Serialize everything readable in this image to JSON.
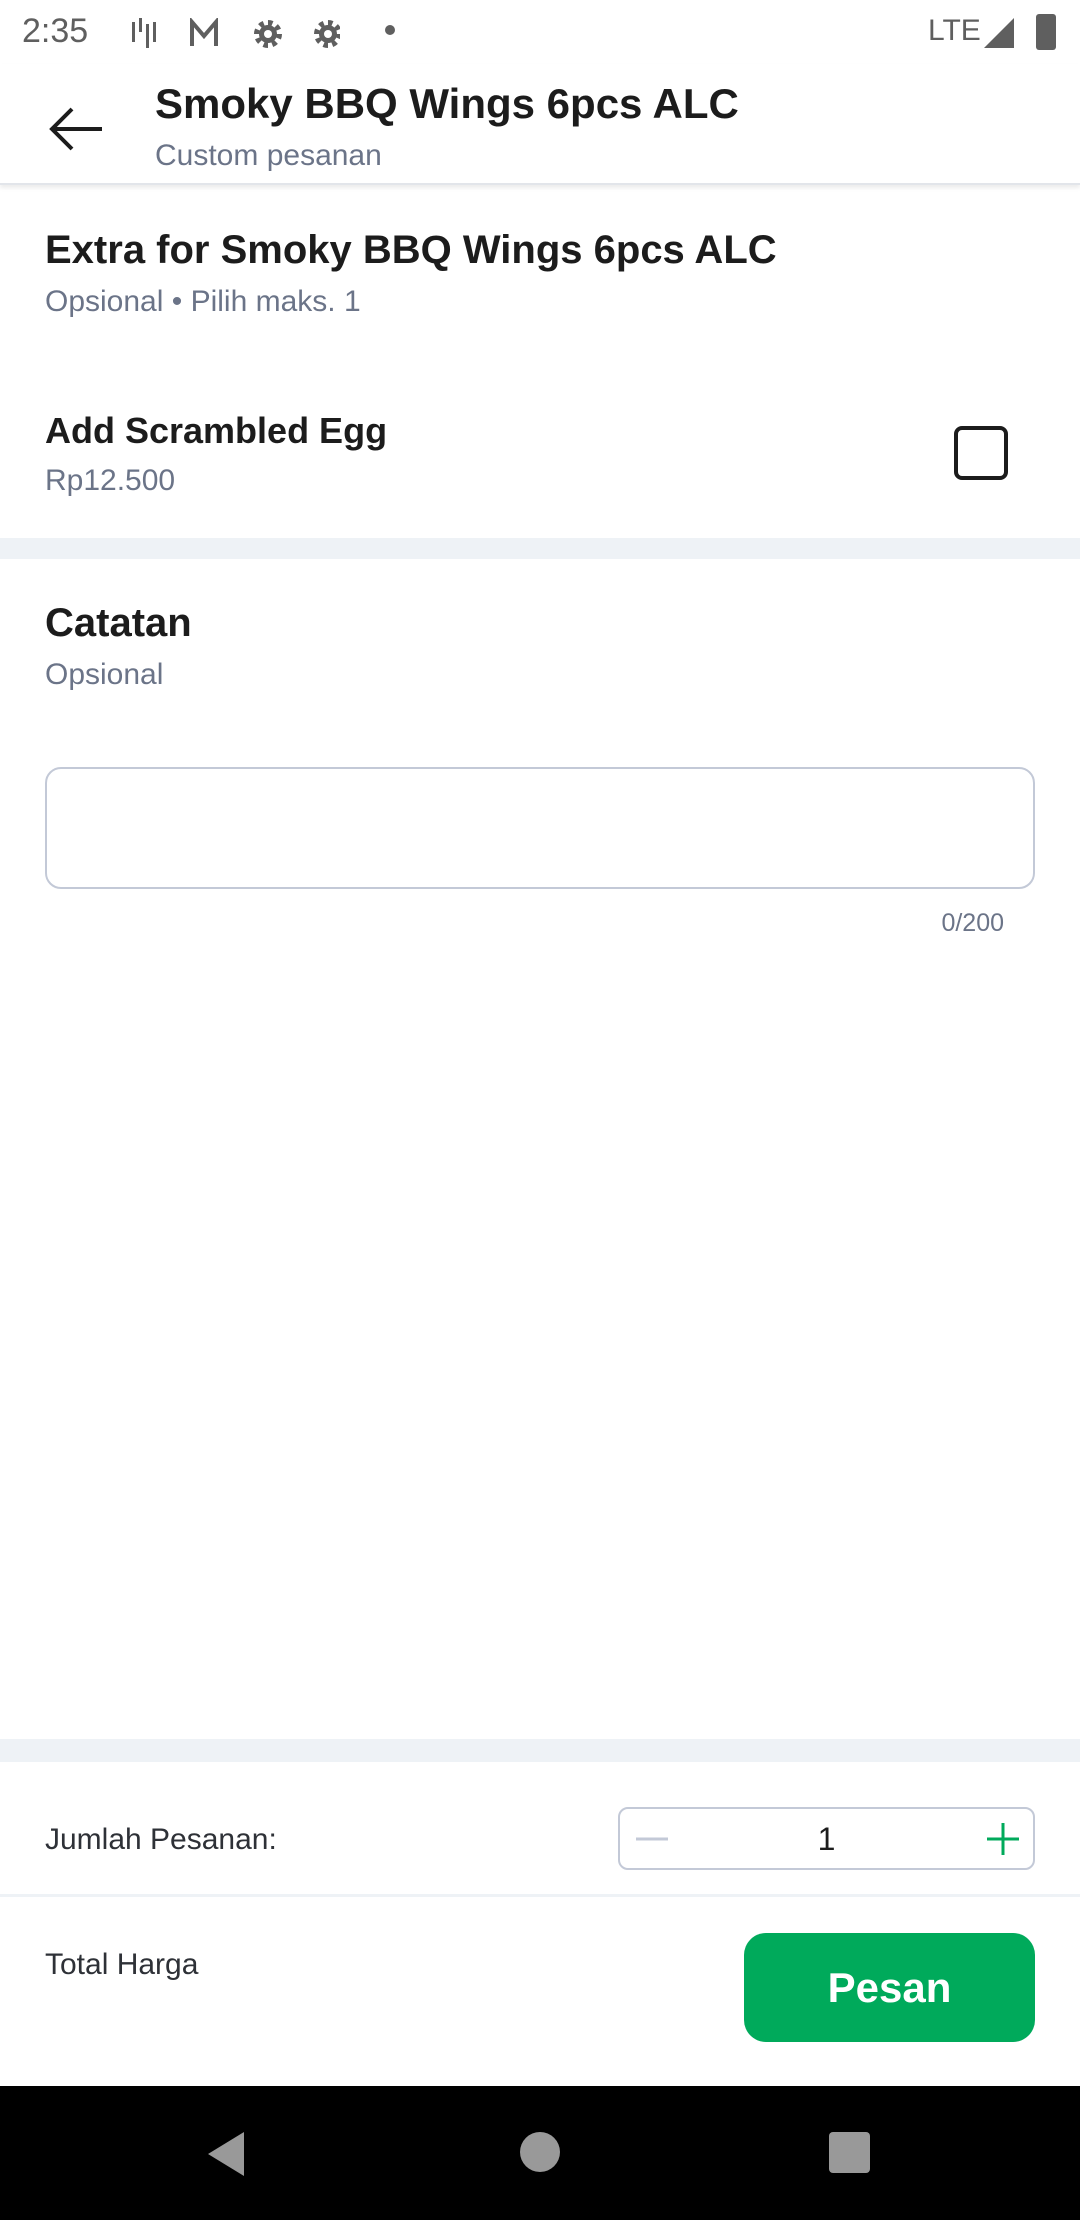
{
  "status_bar": {
    "time": "2:35",
    "network": "LTE",
    "icons": [
      "signal-bars-icon",
      "gmail-icon",
      "settings-icon",
      "settings-icon",
      "dot-icon",
      "cell-signal-icon",
      "battery-icon"
    ]
  },
  "header": {
    "title": "Smoky BBQ Wings 6pcs ALC",
    "subtitle": "Custom pesanan"
  },
  "extra": {
    "title": "Extra for Smoky BBQ Wings 6pcs ALC",
    "subtitle": "Opsional • Pilih maks. 1",
    "options": [
      {
        "label": "Add Scrambled Egg",
        "price": "Rp12.500",
        "checked": false
      }
    ]
  },
  "notes": {
    "title": "Catatan",
    "subtitle": "Opsional",
    "value": "",
    "counter": "0/200"
  },
  "quantity": {
    "label": "Jumlah Pesanan:",
    "value": "1"
  },
  "footer": {
    "total_label": "Total Harga",
    "order_button": "Pesan"
  },
  "colors": {
    "accent": "#00aa5b",
    "band": "#eef2f6"
  }
}
